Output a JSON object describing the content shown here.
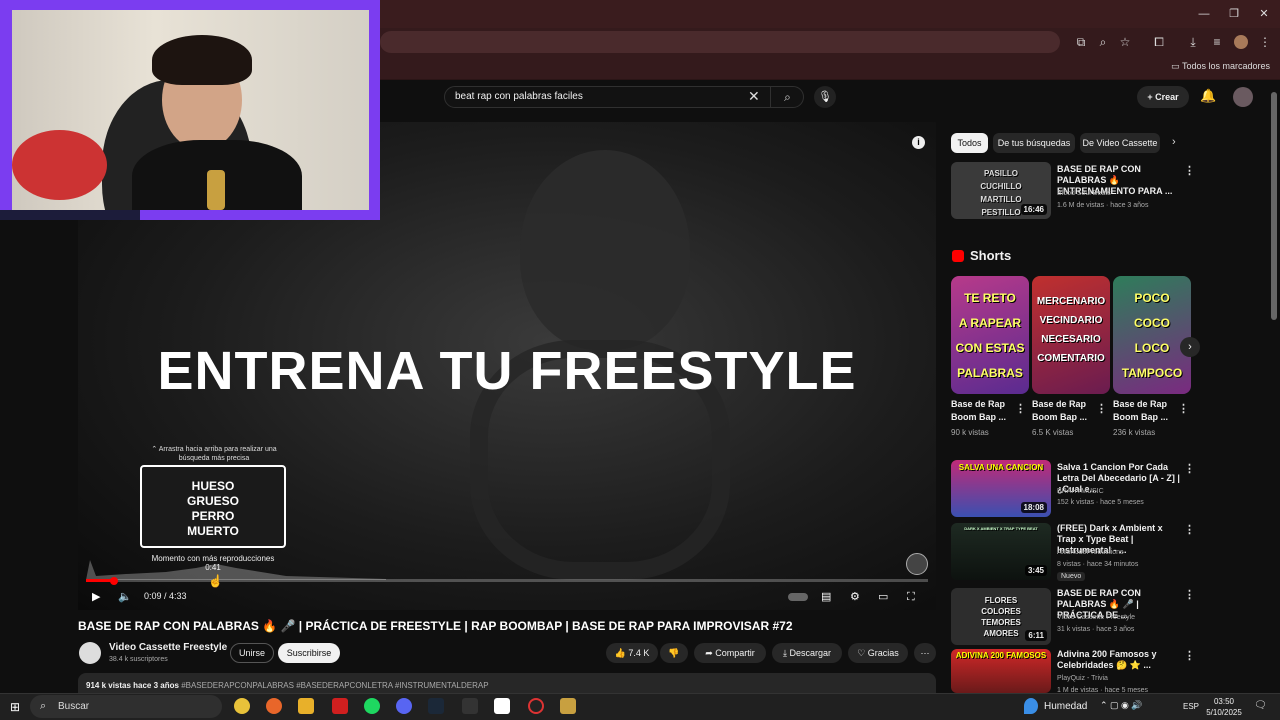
{
  "browser": {
    "bookmarks_label": "Todos los marcadores"
  },
  "header": {
    "search_value": "beat rap con palabras faciles",
    "create_label": "Crear"
  },
  "player": {
    "overlay_title": "ENTRENA TU FREESTYLE",
    "drag_hint": "Arrastra hacia arriba para realizar una búsqueda más precisa",
    "preview_lines": [
      "HUESO",
      "GRUESO",
      "PERRO",
      "MUERTO"
    ],
    "most_replayed": "Momento con más reproducciones",
    "hover_time": "0:41",
    "time": "0:09 / 4:33",
    "progress": 0.033
  },
  "video": {
    "title": "BASE DE RAP CON PALABRAS 🔥 🎤 | PRÁCTICA DE FREESTYLE | RAP BOOMBAP | BASE DE RAP PARA IMPROVISAR #72",
    "channel": "Video Cassette Freestyle",
    "subscribers": "38.4 k suscriptores",
    "join": "Unirse",
    "subscribe": "Suscribirse",
    "likes": "7.4 K",
    "share": "Compartir",
    "download": "Descargar",
    "thanks": "Gracias",
    "desc_stats": "914 k vistas  hace 3 años",
    "desc_tags": "#BASEDERAPCONPALABRAS #BASEDERAPCONLETRA #INSTRUMENTALDERAP"
  },
  "sidebar": {
    "chips": [
      "Todos",
      "De tus búsquedas",
      "De Video Cassette"
    ],
    "first": {
      "title": "BASE DE RAP CON PALABRAS 🔥ENTRENAMIENTO PARA ...",
      "channel": "Blood Soul Beats",
      "meta": "1.6 M de vistas · hace 3 años",
      "duration": "16:46",
      "thumb_lines": [
        "PASILLO",
        "CUCHILLO",
        "MARTILLO",
        "PESTILLO"
      ]
    },
    "shorts_label": "Shorts",
    "shorts": [
      {
        "title": "Base de Rap Boom Bap ...",
        "views": "90 k vistas",
        "lines": [
          "TE RETO",
          "A RAPEAR",
          "CON ESTAS",
          "PALABRAS"
        ]
      },
      {
        "title": "Base de Rap Boom Bap ...",
        "views": "6.5 K vistas",
        "lines": [
          "MERCENARIO",
          "VECINDARIO",
          "NECESARIO",
          "COMENTARIO"
        ]
      },
      {
        "title": "Base de Rap Boom Bap ...",
        "views": "236 k vistas",
        "lines": [
          "POCO",
          "COCO",
          "LOCO",
          "TAMPOCO"
        ]
      }
    ],
    "videos": [
      {
        "title": "Salva 1 Cancion Por Cada Letra Del Abecedario [A - Z] | ¿Cual e...",
        "channel": "BRAHYMUSIC",
        "meta": "152 k vistas · hace 5 meses",
        "duration": "18:08",
        "badge": "",
        "thumb_text": "SALVA UNA CANCION"
      },
      {
        "title": "(FREE) Dark x Ambient x Trap x Type Beat | Instrumental - ...",
        "channel": "AxisKodeProductions",
        "meta": "8 vistas · hace 34 minutos",
        "duration": "3:45",
        "badge": "Nuevo",
        "thumb_text": "DARK X AMBIENT X TRAP TYPE BEAT"
      },
      {
        "title": "BASE DE RAP CON PALABRAS 🔥 🎤 | PRÁCTICA DE ...",
        "channel": "Video Cassette Freestyle",
        "meta": "31 k vistas · hace 3 años",
        "duration": "6:11",
        "badge": "",
        "thumb_text": ""
      },
      {
        "title": "Adivina 200 Famosos y Celebridades 🤔 ⭐ ...",
        "channel": "PlayQuiz - Trivia",
        "meta": "1 M de vistas · hace 5 meses",
        "duration": "",
        "badge": "",
        "thumb_text": "ADIVINA 200 FAMOSOS"
      }
    ],
    "video3_lines": [
      "FLORES",
      "COLORES",
      "TEMORES",
      "AMORES"
    ]
  },
  "taskbar": {
    "search": "Buscar",
    "weather": "Humedad",
    "lang": "ESP",
    "time": "03:50",
    "date": "5/10/2025"
  },
  "colors": {
    "accent": "#ff0000",
    "cam_border": "#7b3df0",
    "chrome": "#3a1c1e"
  }
}
